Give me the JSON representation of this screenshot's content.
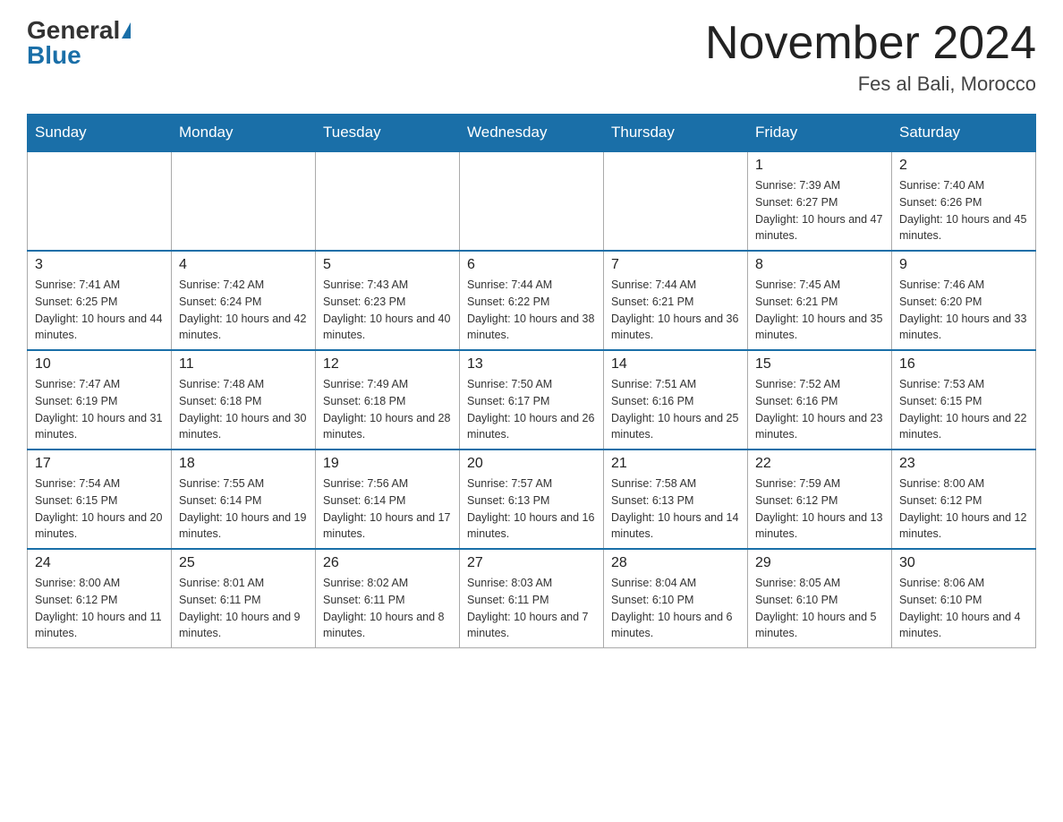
{
  "header": {
    "logo_general": "General",
    "logo_blue": "Blue",
    "title": "November 2024",
    "subtitle": "Fes al Bali, Morocco"
  },
  "days_of_week": [
    "Sunday",
    "Monday",
    "Tuesday",
    "Wednesday",
    "Thursday",
    "Friday",
    "Saturday"
  ],
  "weeks": [
    [
      {
        "day": "",
        "info": ""
      },
      {
        "day": "",
        "info": ""
      },
      {
        "day": "",
        "info": ""
      },
      {
        "day": "",
        "info": ""
      },
      {
        "day": "",
        "info": ""
      },
      {
        "day": "1",
        "info": "Sunrise: 7:39 AM\nSunset: 6:27 PM\nDaylight: 10 hours and 47 minutes."
      },
      {
        "day": "2",
        "info": "Sunrise: 7:40 AM\nSunset: 6:26 PM\nDaylight: 10 hours and 45 minutes."
      }
    ],
    [
      {
        "day": "3",
        "info": "Sunrise: 7:41 AM\nSunset: 6:25 PM\nDaylight: 10 hours and 44 minutes."
      },
      {
        "day": "4",
        "info": "Sunrise: 7:42 AM\nSunset: 6:24 PM\nDaylight: 10 hours and 42 minutes."
      },
      {
        "day": "5",
        "info": "Sunrise: 7:43 AM\nSunset: 6:23 PM\nDaylight: 10 hours and 40 minutes."
      },
      {
        "day": "6",
        "info": "Sunrise: 7:44 AM\nSunset: 6:22 PM\nDaylight: 10 hours and 38 minutes."
      },
      {
        "day": "7",
        "info": "Sunrise: 7:44 AM\nSunset: 6:21 PM\nDaylight: 10 hours and 36 minutes."
      },
      {
        "day": "8",
        "info": "Sunrise: 7:45 AM\nSunset: 6:21 PM\nDaylight: 10 hours and 35 minutes."
      },
      {
        "day": "9",
        "info": "Sunrise: 7:46 AM\nSunset: 6:20 PM\nDaylight: 10 hours and 33 minutes."
      }
    ],
    [
      {
        "day": "10",
        "info": "Sunrise: 7:47 AM\nSunset: 6:19 PM\nDaylight: 10 hours and 31 minutes."
      },
      {
        "day": "11",
        "info": "Sunrise: 7:48 AM\nSunset: 6:18 PM\nDaylight: 10 hours and 30 minutes."
      },
      {
        "day": "12",
        "info": "Sunrise: 7:49 AM\nSunset: 6:18 PM\nDaylight: 10 hours and 28 minutes."
      },
      {
        "day": "13",
        "info": "Sunrise: 7:50 AM\nSunset: 6:17 PM\nDaylight: 10 hours and 26 minutes."
      },
      {
        "day": "14",
        "info": "Sunrise: 7:51 AM\nSunset: 6:16 PM\nDaylight: 10 hours and 25 minutes."
      },
      {
        "day": "15",
        "info": "Sunrise: 7:52 AM\nSunset: 6:16 PM\nDaylight: 10 hours and 23 minutes."
      },
      {
        "day": "16",
        "info": "Sunrise: 7:53 AM\nSunset: 6:15 PM\nDaylight: 10 hours and 22 minutes."
      }
    ],
    [
      {
        "day": "17",
        "info": "Sunrise: 7:54 AM\nSunset: 6:15 PM\nDaylight: 10 hours and 20 minutes."
      },
      {
        "day": "18",
        "info": "Sunrise: 7:55 AM\nSunset: 6:14 PM\nDaylight: 10 hours and 19 minutes."
      },
      {
        "day": "19",
        "info": "Sunrise: 7:56 AM\nSunset: 6:14 PM\nDaylight: 10 hours and 17 minutes."
      },
      {
        "day": "20",
        "info": "Sunrise: 7:57 AM\nSunset: 6:13 PM\nDaylight: 10 hours and 16 minutes."
      },
      {
        "day": "21",
        "info": "Sunrise: 7:58 AM\nSunset: 6:13 PM\nDaylight: 10 hours and 14 minutes."
      },
      {
        "day": "22",
        "info": "Sunrise: 7:59 AM\nSunset: 6:12 PM\nDaylight: 10 hours and 13 minutes."
      },
      {
        "day": "23",
        "info": "Sunrise: 8:00 AM\nSunset: 6:12 PM\nDaylight: 10 hours and 12 minutes."
      }
    ],
    [
      {
        "day": "24",
        "info": "Sunrise: 8:00 AM\nSunset: 6:12 PM\nDaylight: 10 hours and 11 minutes."
      },
      {
        "day": "25",
        "info": "Sunrise: 8:01 AM\nSunset: 6:11 PM\nDaylight: 10 hours and 9 minutes."
      },
      {
        "day": "26",
        "info": "Sunrise: 8:02 AM\nSunset: 6:11 PM\nDaylight: 10 hours and 8 minutes."
      },
      {
        "day": "27",
        "info": "Sunrise: 8:03 AM\nSunset: 6:11 PM\nDaylight: 10 hours and 7 minutes."
      },
      {
        "day": "28",
        "info": "Sunrise: 8:04 AM\nSunset: 6:10 PM\nDaylight: 10 hours and 6 minutes."
      },
      {
        "day": "29",
        "info": "Sunrise: 8:05 AM\nSunset: 6:10 PM\nDaylight: 10 hours and 5 minutes."
      },
      {
        "day": "30",
        "info": "Sunrise: 8:06 AM\nSunset: 6:10 PM\nDaylight: 10 hours and 4 minutes."
      }
    ]
  ]
}
